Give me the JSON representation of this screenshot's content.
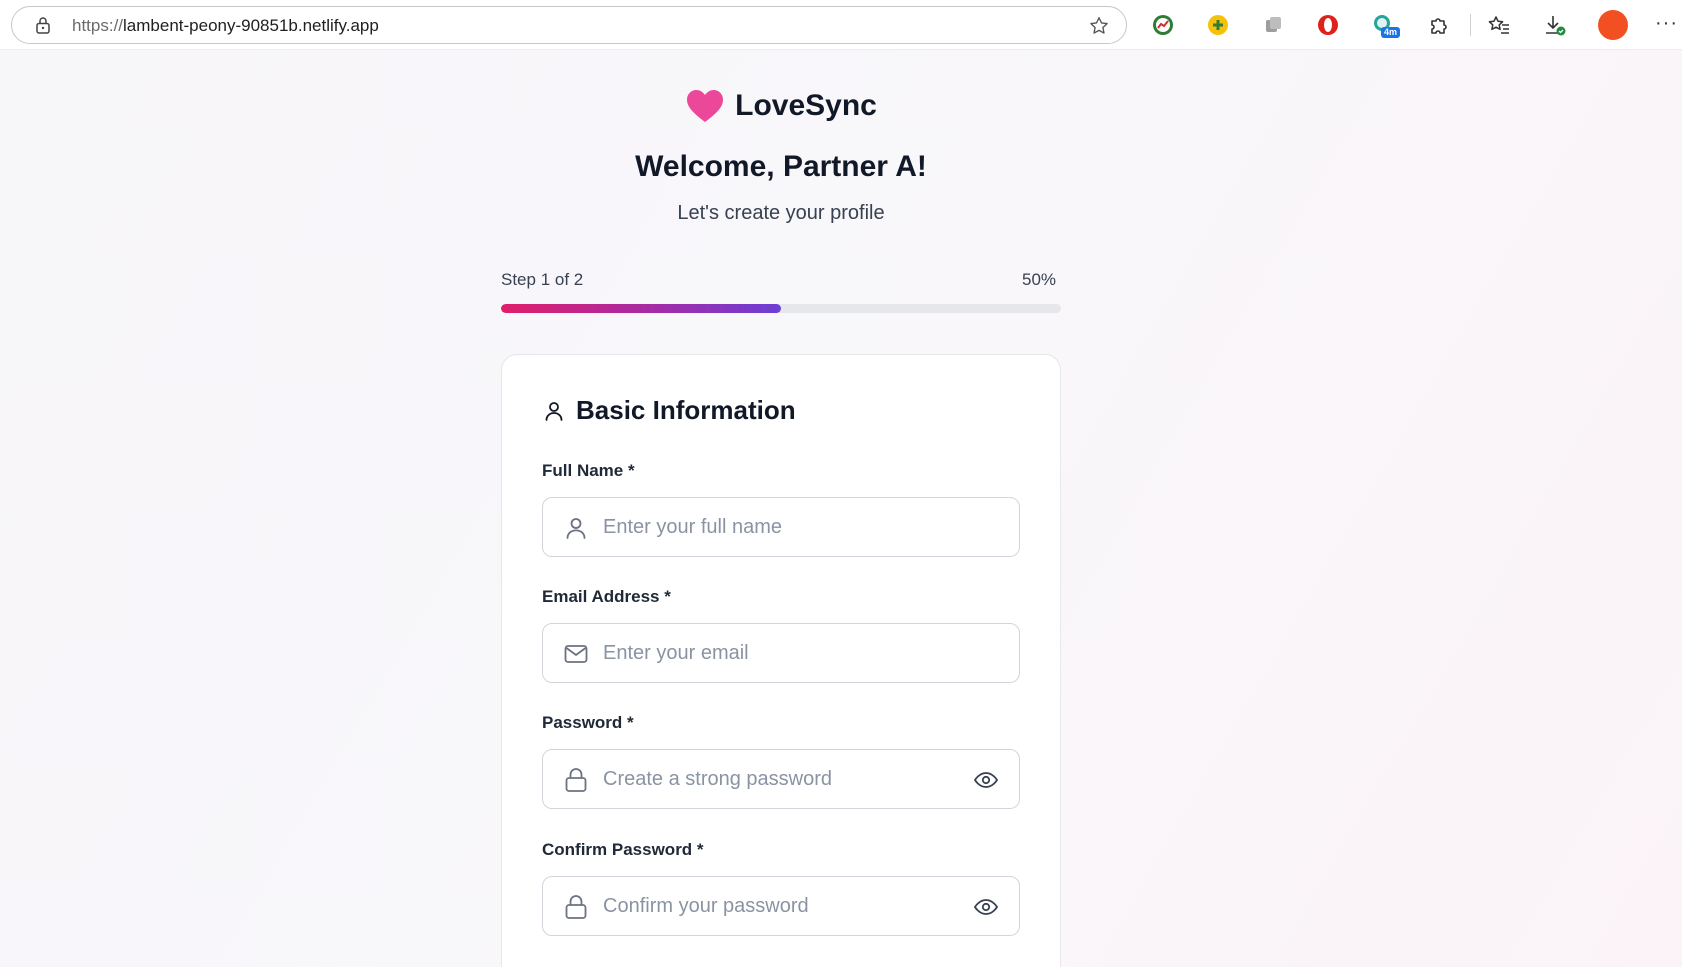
{
  "browser": {
    "url_scheme": "https://",
    "url_host": "lambent-peony-90851b.netlify.app",
    "extensions": [
      "green-chart-extension-icon",
      "yellow-plus-extension-icon",
      "gray-stack-extension-icon",
      "opera-red-extension-icon",
      "teal-timer-extension-icon",
      "puzzle-icon"
    ],
    "timer_badge": "4m",
    "profile_color": "#f25022"
  },
  "app": {
    "brand_name": "LoveSync",
    "brand_color": "#ec4899",
    "welcome_title": "Welcome, Partner A!",
    "subtitle": "Let's create your profile"
  },
  "progress": {
    "step_label": "Step 1 of 2",
    "percent_label": "50%",
    "value": 0.5
  },
  "form": {
    "section_title": "Basic Information",
    "fields": [
      {
        "label": "Full Name *",
        "placeholder": "Enter your full name",
        "icon": "user-icon"
      },
      {
        "label": "Email Address *",
        "placeholder": "Enter your email",
        "icon": "mail-icon"
      },
      {
        "label": "Password *",
        "placeholder": "Create a strong password",
        "icon": "lock-icon"
      },
      {
        "label": "Confirm Password *",
        "placeholder": "Confirm your password",
        "icon": "lock-icon"
      }
    ]
  }
}
